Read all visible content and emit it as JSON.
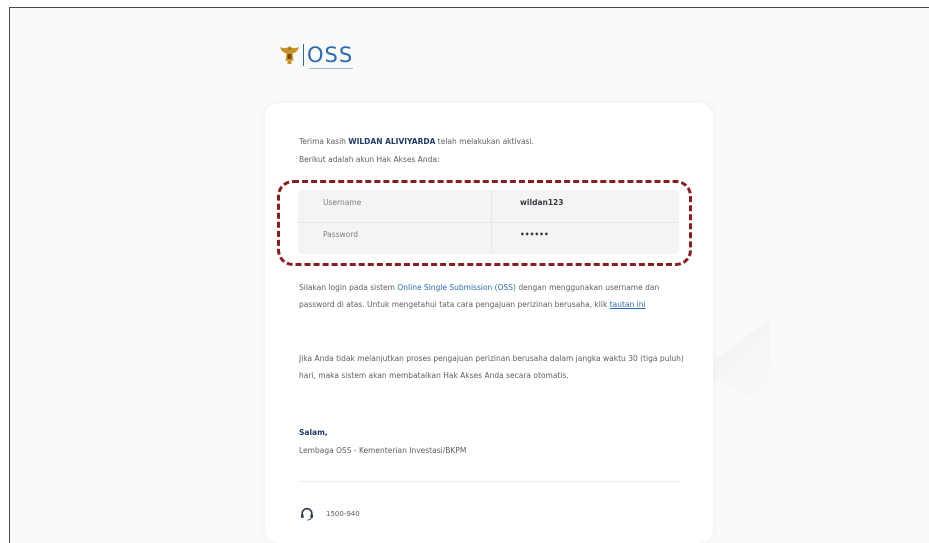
{
  "logo": {
    "brand": "OSS"
  },
  "greeting": {
    "prefix": "Terima kasih",
    "name": "WILDAN ALIVIYARDA",
    "suffix": "telah melakukan aktivasi.",
    "line2": "Berikut adalah akun Hak Akses Anda:"
  },
  "credentials": {
    "username_label": "Username",
    "username_value": "wildan123",
    "password_label": "Password",
    "password_value": "••••••"
  },
  "instructions": {
    "p1_a": "Silakan login pada sistem",
    "p1_link": "Online Single Submission (OSS)",
    "p1_b": "dengan menggunakan username dan password di atas. Untuk mengetahui tata cara pengajuan perizinan berusaha, klik",
    "p1_link2": "tautan ini"
  },
  "warning": {
    "text": "Jika Anda tidak melanjutkan proses pengajuan perizinan berusaha dalam jangka waktu 30 (tiga puluh) hari, maka sistem akan membatalkan Hak Akses Anda secara otomatis."
  },
  "signature": {
    "salam": "Salam,",
    "org": "Lembaga OSS - Kementerian Investasi/BKPM"
  },
  "contact": {
    "phone": "1500-940"
  },
  "colors": {
    "accent": "#2a6bb0",
    "name": "#1f3a68",
    "highlight": "#8a1c23"
  }
}
